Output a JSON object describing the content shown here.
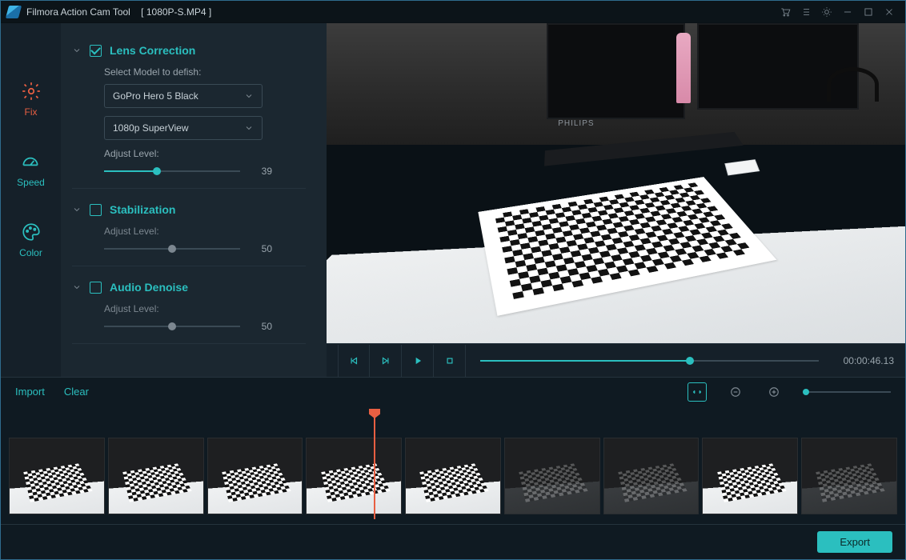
{
  "titlebar": {
    "app_name": "Filmora Action Cam Tool",
    "filename": "[ 1080P-S.MP4 ]"
  },
  "tabs": {
    "fix": "Fix",
    "speed": "Speed",
    "color": "Color"
  },
  "lens": {
    "title": "Lens Correction",
    "enabled": true,
    "expanded": true,
    "select_label": "Select Model to defish:",
    "model": "GoPro Hero 5 Black",
    "mode": "1080p SuperView",
    "adjust_label": "Adjust Level:",
    "level": 39,
    "level_pct": 39
  },
  "stab": {
    "title": "Stabilization",
    "enabled": false,
    "expanded": false,
    "adjust_label": "Adjust Level:",
    "level": 50,
    "level_pct": 50
  },
  "denoise": {
    "title": "Audio Denoise",
    "enabled": false,
    "expanded": false,
    "adjust_label": "Adjust Level:",
    "level": 50,
    "level_pct": 50
  },
  "playback": {
    "position_pct": 62,
    "time": "00:00:46.13"
  },
  "toolrow": {
    "import": "Import",
    "clear": "Clear"
  },
  "footer": {
    "export": "Export"
  },
  "preview": {
    "monitor_brand": "PHILIPS"
  }
}
